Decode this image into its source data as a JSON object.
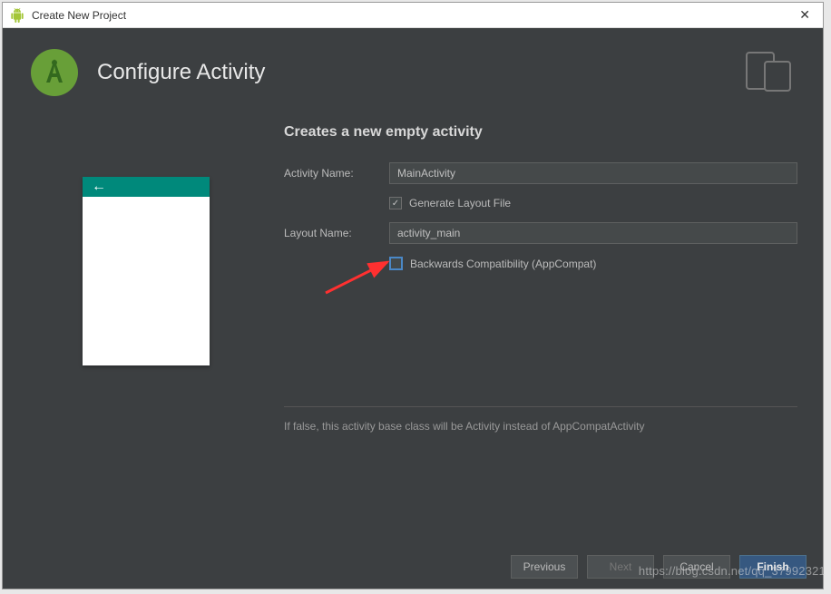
{
  "window": {
    "title": "Create New Project"
  },
  "header": {
    "title": "Configure Activity"
  },
  "form": {
    "section_title": "Creates a new empty activity",
    "activity_name_label": "Activity Name:",
    "activity_name_value": "MainActivity",
    "generate_layout_label": "Generate Layout File",
    "generate_layout_checked": true,
    "layout_name_label": "Layout Name:",
    "layout_name_value": "activity_main",
    "backwards_compat_label": "Backwards Compatibility (AppCompat)",
    "backwards_compat_checked": false,
    "hint_text": "If false, this activity base class will be Activity instead of AppCompatActivity"
  },
  "footer": {
    "previous": "Previous",
    "next": "Next",
    "cancel": "Cancel",
    "finish": "Finish"
  },
  "watermark": "https://blog.csdn.net/qq_37992321",
  "icons": {
    "back_arrow": "←"
  }
}
